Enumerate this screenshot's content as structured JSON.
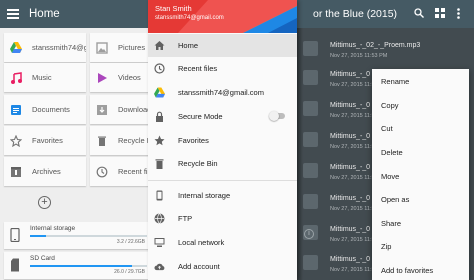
{
  "left": {
    "title": "Home",
    "tiles": [
      {
        "label": "stanssmith74@gm",
        "icon": "drive-icon"
      },
      {
        "label": "Pictures",
        "icon": "image-icon"
      },
      {
        "label": "Music",
        "icon": "music-icon"
      },
      {
        "label": "Videos",
        "icon": "video-icon"
      },
      {
        "label": "Documents",
        "icon": "documents-icon"
      },
      {
        "label": "Download",
        "icon": "download-icon"
      },
      {
        "label": "Favorites",
        "icon": "star-icon"
      },
      {
        "label": "Recycle Bin",
        "icon": "trash-icon"
      },
      {
        "label": "Archives",
        "icon": "archive-icon"
      },
      {
        "label": "Recent files",
        "icon": "clock-icon"
      }
    ],
    "storage": [
      {
        "name": "Internal storage",
        "size": "3.2 / 22.6GB",
        "used_fraction": 0.14
      },
      {
        "name": "SD Card",
        "size": "26.0 / 29.7GB",
        "used_fraction": 0.875
      }
    ]
  },
  "drawer": {
    "user_name": "Stan Smith",
    "user_email": "stanssmith74@gmail.com",
    "items": [
      {
        "label": "Home",
        "icon": "home-icon",
        "active": true
      },
      {
        "label": "Recent files",
        "icon": "clock-icon"
      },
      {
        "label": "stanssmith74@gmail.com",
        "icon": "drive-icon"
      },
      {
        "label": "Secure Mode",
        "icon": "lock-icon",
        "toggle_on": false
      },
      {
        "label": "Favorites",
        "icon": "star-icon"
      },
      {
        "label": "Recycle Bin",
        "icon": "trash-icon"
      },
      {
        "label": "Internal storage",
        "icon": "phone-icon"
      },
      {
        "label": "FTP",
        "icon": "globe-icon"
      },
      {
        "label": "Local network",
        "icon": "network-icon"
      },
      {
        "label": "Add account",
        "icon": "cloud-upload-icon"
      }
    ]
  },
  "right": {
    "title": "or the Blue (2015)",
    "files": [
      {
        "name": "Mittimus_-_02_-_Proem.mp3",
        "date": "Nov 27, 2015 11:53 PM"
      },
      {
        "name": "Mittimus_-_0",
        "date": "Nov 27, 2015 11:53"
      },
      {
        "name": "Mittimus_-_0",
        "date": "Nov 27, 2015 11:53"
      },
      {
        "name": "Mittimus_-_0",
        "date": "Nov 27, 2015 11:53"
      },
      {
        "name": "Mittimus_-_0",
        "date": "Nov 27, 2015 11:53"
      },
      {
        "name": "Mittimus_-_0",
        "date": "Nov 27, 2015 11:53"
      },
      {
        "name": "Mittimus_-_0",
        "date": "Nov 27, 2015 11:53"
      },
      {
        "name": "Mittimus_-_0",
        "date": "Nov 27, 2015 11:53"
      }
    ],
    "context_menu": [
      "Rename",
      "Copy",
      "Cut",
      "Delete",
      "Move",
      "Open as",
      "Share",
      "Zip",
      "Add to favorites"
    ]
  }
}
